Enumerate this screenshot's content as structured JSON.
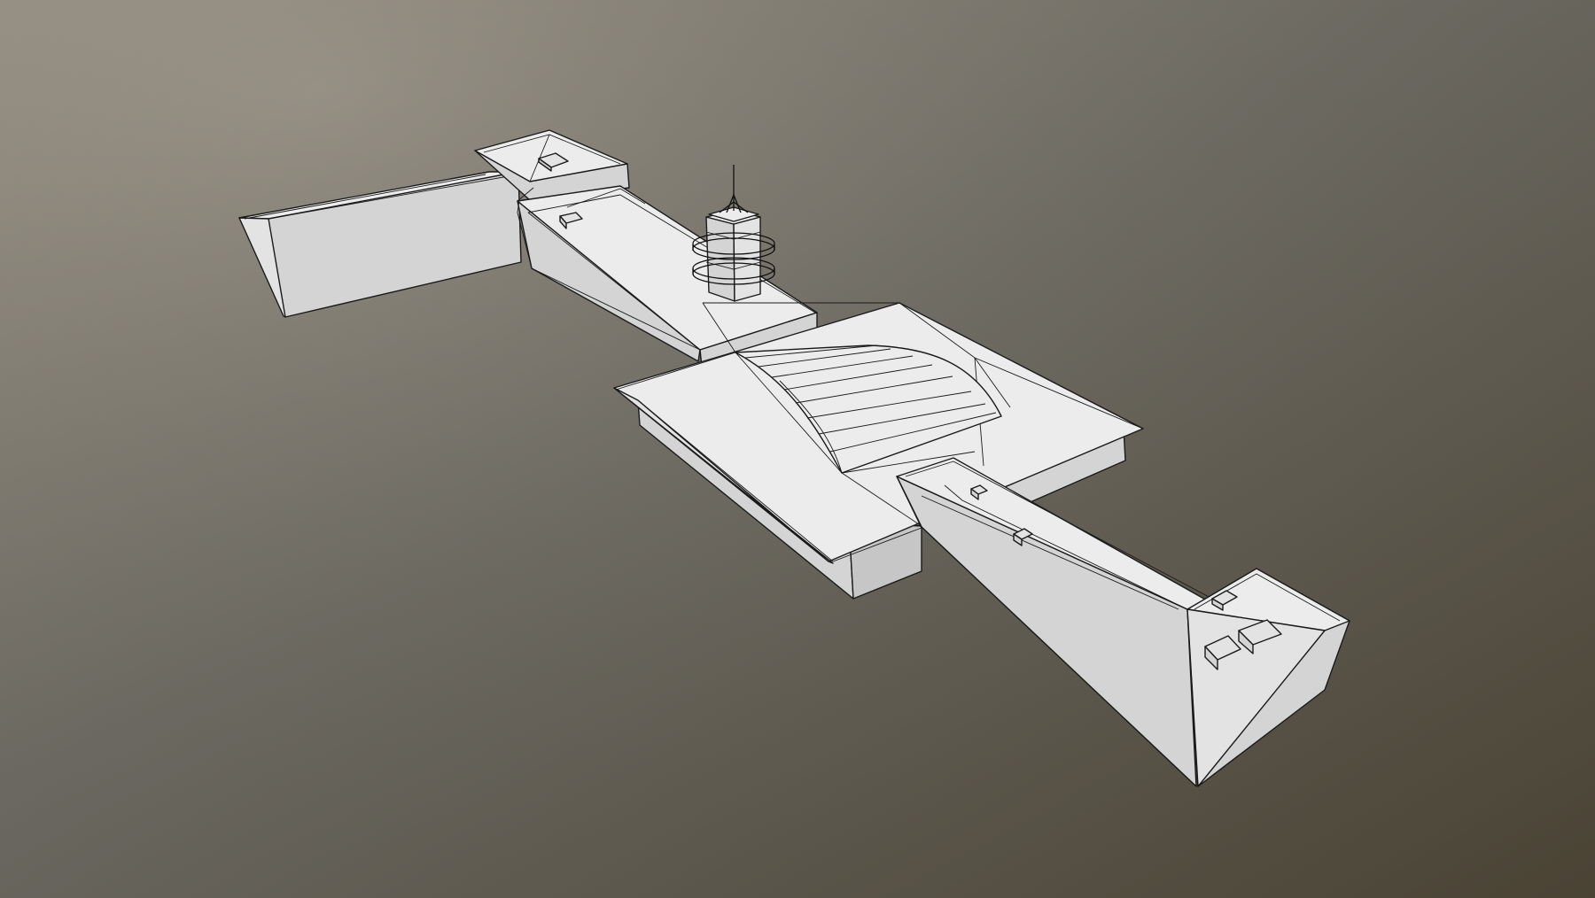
{
  "scene": {
    "render_mode": "clay-wireframe",
    "background": {
      "top_left": "#9a9488",
      "top_right": "#6c6a63",
      "bottom_left": "#655b4c",
      "bottom_right": "#4a4334"
    },
    "material": {
      "top": "#ececec",
      "side": "#d4d4d4",
      "edge": "#1a1a1a"
    }
  }
}
